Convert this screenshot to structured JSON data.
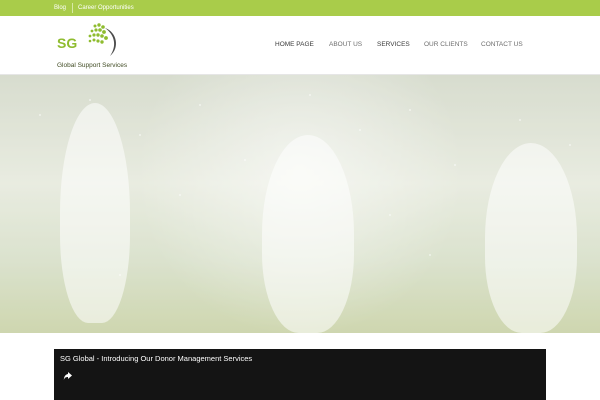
{
  "topbar": {
    "links": [
      "Blog",
      "Career Opportunities"
    ]
  },
  "logo": {
    "initials": "SG",
    "company": "Global Support Services"
  },
  "nav": {
    "items": [
      "HOME PAGE",
      "ABOUT US",
      "SERVICES",
      "OUR CLIENTS",
      "CONTACT US"
    ]
  },
  "hero": {
    "image": "children-playing-in-water-photo"
  },
  "video": {
    "title": "SG Global - Introducing Our Donor Management Services",
    "share_icon": "share-arrow-icon"
  },
  "colors": {
    "accent_green": "#a9cc4a",
    "video_bg": "#141414"
  }
}
